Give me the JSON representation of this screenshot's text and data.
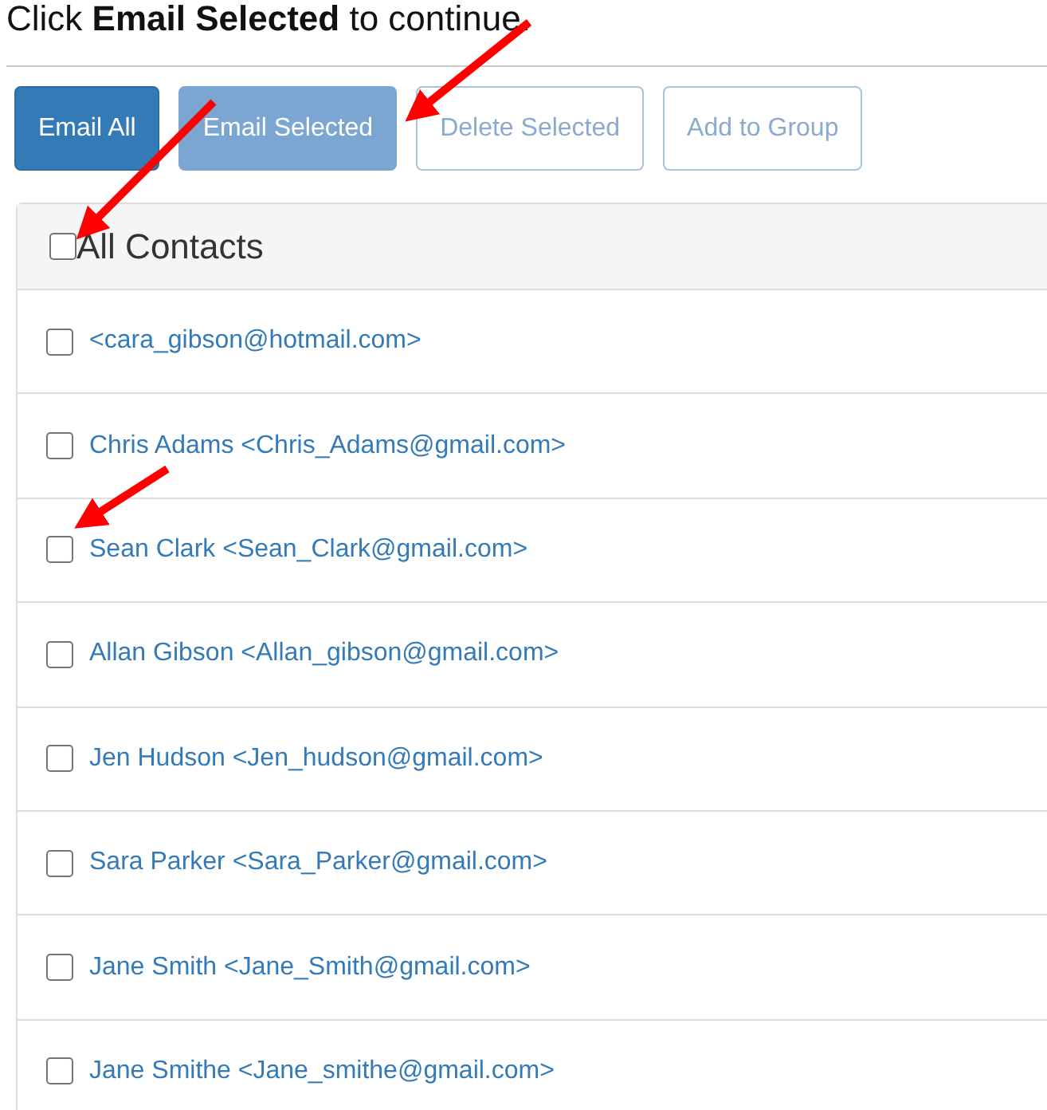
{
  "instruction": "Click **Email Selected** to continue.",
  "buttons": [
    {
      "label": "Email All",
      "kind": "primary",
      "disabled": false
    },
    {
      "label": "Email Selected",
      "kind": "primary",
      "disabled": true
    },
    {
      "label": "Delete Selected",
      "kind": "outline",
      "disabled": true
    },
    {
      "label": "Add to Group",
      "kind": "outline",
      "disabled": true
    }
  ],
  "contacts_header": {
    "label": "All Contacts",
    "checked": false
  },
  "contacts": [
    {
      "label": "<cara_gibson@hotmail.com>",
      "checked": false
    },
    {
      "label": "Chris Adams <Chris_Adams@gmail.com>",
      "checked": false
    },
    {
      "label": "Sean Clark <Sean_Clark@gmail.com>",
      "checked": false
    },
    {
      "label": "Allan Gibson <Allan_gibson@gmail.com>",
      "checked": false
    },
    {
      "label": "Jen Hudson <Jen_hudson@gmail.com>",
      "checked": false
    },
    {
      "label": "Sara Parker <Sara_Parker@gmail.com>",
      "checked": false
    },
    {
      "label": "Jane Smith <Jane_Smith@gmail.com>",
      "checked": false
    },
    {
      "label": "Jane Smithe <Jane_smithe@gmail.com>",
      "checked": false
    }
  ]
}
